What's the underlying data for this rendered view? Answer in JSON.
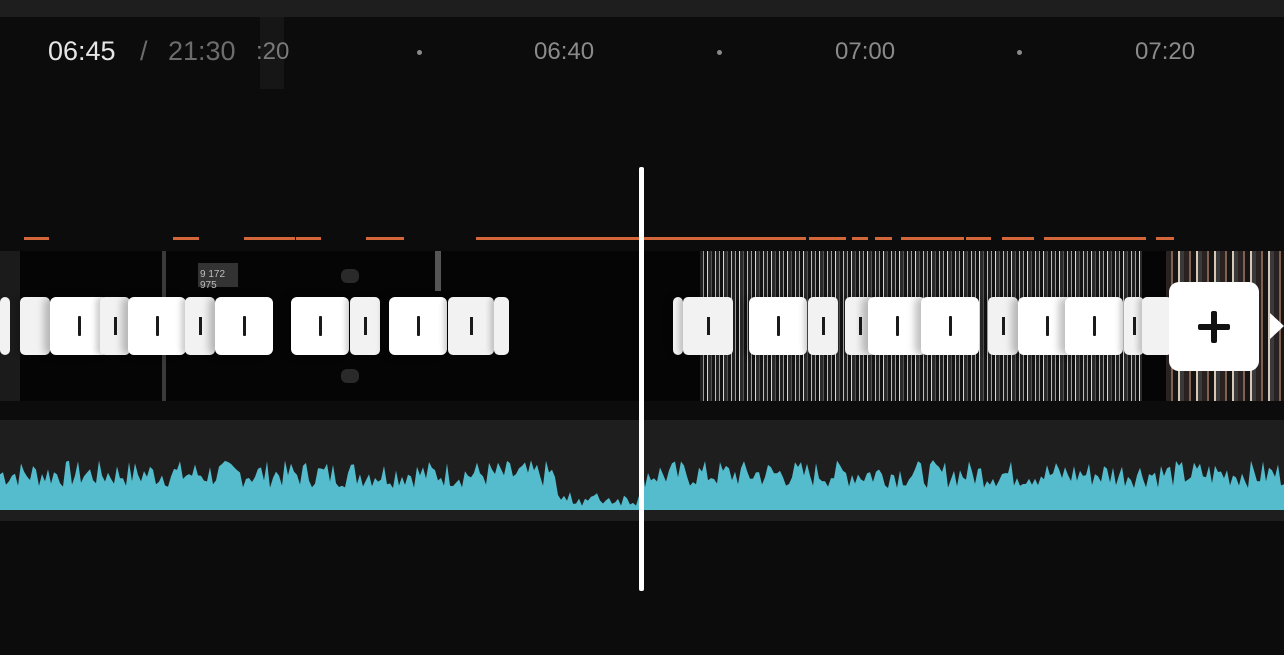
{
  "timecode": {
    "current": "06:45",
    "separator": "/",
    "total": "21:30"
  },
  "ruler": {
    "labels": [
      ":20",
      "06:40",
      "07:00",
      "07:20"
    ]
  },
  "clip_overlay_text": {
    "number": "9 172 975"
  },
  "colors": {
    "background": "#0c0c0c",
    "marker": "#d4673a",
    "waveform": "#54bccc",
    "playhead": "#ffffff",
    "handle": "#ffffff"
  },
  "icons": {
    "add": "plus-icon",
    "handle": "trim-handle-icon",
    "play": "play-triangle-icon"
  }
}
